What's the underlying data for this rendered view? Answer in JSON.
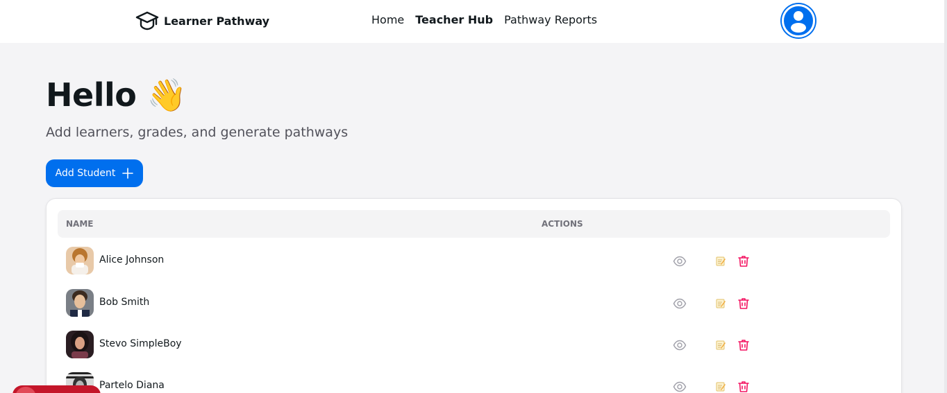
{
  "nav": {
    "brand": "Learner Pathway",
    "links": [
      {
        "label": "Home",
        "active": false
      },
      {
        "label": "Teacher Hub",
        "active": true
      },
      {
        "label": "Pathway Reports",
        "active": false
      }
    ]
  },
  "hero": {
    "title": "Hello 👋",
    "subtitle": "Add learners, grades, and generate pathways"
  },
  "add_button": {
    "label": "Add Student",
    "icon": "plus-icon"
  },
  "table": {
    "columns": [
      "NAME",
      "ACTIONS"
    ],
    "rows": [
      {
        "name": "Alice Johnson"
      },
      {
        "name": "Bob Smith"
      },
      {
        "name": "Stevo SimpleBoy"
      },
      {
        "name": "Partelo Diana"
      }
    ],
    "actions": [
      "eye-icon",
      "edit-icon",
      "trash-icon"
    ]
  },
  "colors": {
    "primary": "#006fee",
    "danger": "#f31260",
    "background": "#f4f4f6"
  }
}
